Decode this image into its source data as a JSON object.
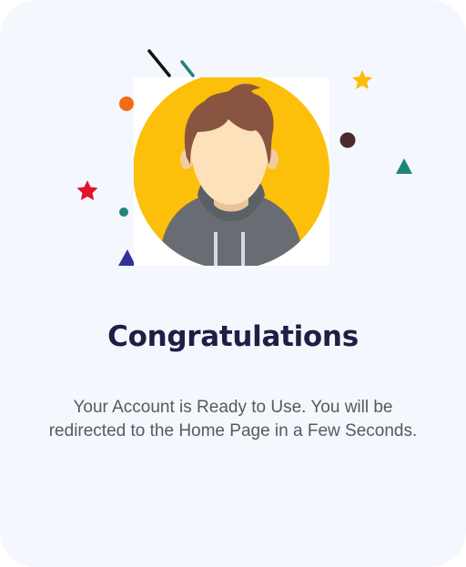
{
  "success": {
    "title": "Congratulations",
    "message": "Your Account is Ready to Use. You will be redirected to the Home Page in a Few Seconds."
  },
  "illustration": {
    "avatar": "user-avatar",
    "confetti": [
      "star-icon",
      "star-icon",
      "circle-icon",
      "circle-icon",
      "circle-icon",
      "triangle-icon",
      "triangle-icon",
      "line-icon",
      "line-icon"
    ]
  },
  "colors": {
    "card_background": "#f4f7fd",
    "title": "#1e1f45",
    "message": "#595959",
    "avatar_circle": "#fcbf0a",
    "hoodie": "#696d73",
    "hair": "#8a5540",
    "skin": "#fce1bb",
    "star_red": "#e2142d",
    "star_yellow": "#fbbc05",
    "dot_orange": "#f36b13",
    "dot_dark": "#4a2a2a",
    "teal": "#1f8578",
    "navy": "#30329a"
  }
}
